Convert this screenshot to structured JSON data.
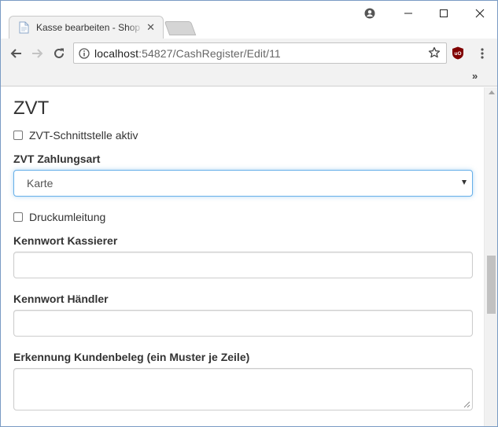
{
  "browser": {
    "tab_title": "Kasse bearbeiten - Shop",
    "url_host": "localhost",
    "url_path": ":54827/CashRegister/Edit/11",
    "ext_label": "uO"
  },
  "page": {
    "section_title": "ZVT",
    "zvt_active_label": "ZVT-Schnittstelle aktiv",
    "zvt_active_checked": false,
    "payment_type_label": "ZVT Zahlungsart",
    "payment_type_value": "Karte",
    "print_redirect_label": "Druckumleitung",
    "print_redirect_checked": false,
    "cashier_password_label": "Kennwort Kassierer",
    "cashier_password_value": "",
    "merchant_password_label": "Kennwort Händler",
    "merchant_password_value": "",
    "receipt_detection_label": "Erkennung Kundenbeleg (ein Muster je Zeile)",
    "receipt_detection_value": ""
  },
  "colors": {
    "focus_border": "#66afe9",
    "text": "#333333",
    "chrome_bg": "#f2f2f2"
  }
}
